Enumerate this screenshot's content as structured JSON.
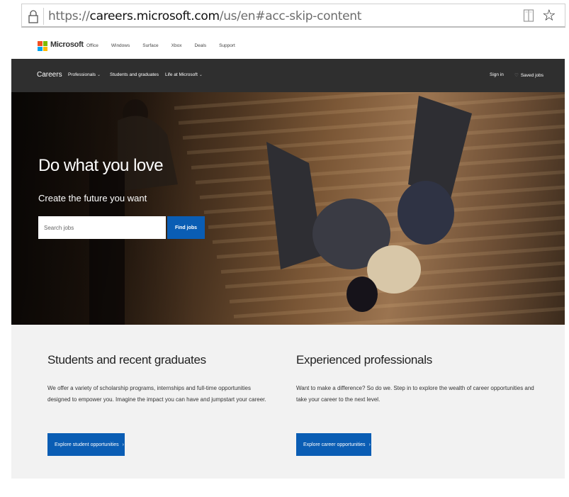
{
  "browser": {
    "url_prefix": "https://",
    "url_domain": "careers.microsoft.com",
    "url_path": "/us/en#acc-skip-content"
  },
  "ms_nav": {
    "brand": "Microsoft",
    "links": [
      "Office",
      "Windows",
      "Surface",
      "Xbox",
      "Deals",
      "Support"
    ],
    "logo_colors": [
      "#f25022",
      "#7fba00",
      "#00a4ef",
      "#ffb900"
    ]
  },
  "careers_nav": {
    "brand": "Careers",
    "items": [
      {
        "label": "Professionals",
        "has_dropdown": true
      },
      {
        "label": "Students and graduates",
        "has_dropdown": false
      },
      {
        "label": "Life at Microsoft",
        "has_dropdown": true
      }
    ],
    "sign_in": "Sign in",
    "saved_jobs": "Saved jobs",
    "chevron_glyph": "⌄",
    "heart_glyph": "♡"
  },
  "hero": {
    "title": "Do what you love",
    "subtitle": "Create the future you want",
    "search_placeholder": "Search jobs",
    "find_button": "Find jobs"
  },
  "students": {
    "title": "Students and recent graduates",
    "text": "We offer a variety of scholarship programs, internships and full-time opportunities designed to empower you. Imagine the impact you can have and jumpstart your career.",
    "button": "Explore student opportunities"
  },
  "professionals": {
    "title": "Experienced professionals",
    "text": "Want to make a difference? So do we. Step in to explore the wealth of career opportunities and take your career to the next level.",
    "button": "Explore career opportunities"
  },
  "colors": {
    "accent": "#0a5db4",
    "nav_dark": "#2f2f2f",
    "section_bg": "#f2f2f2"
  }
}
